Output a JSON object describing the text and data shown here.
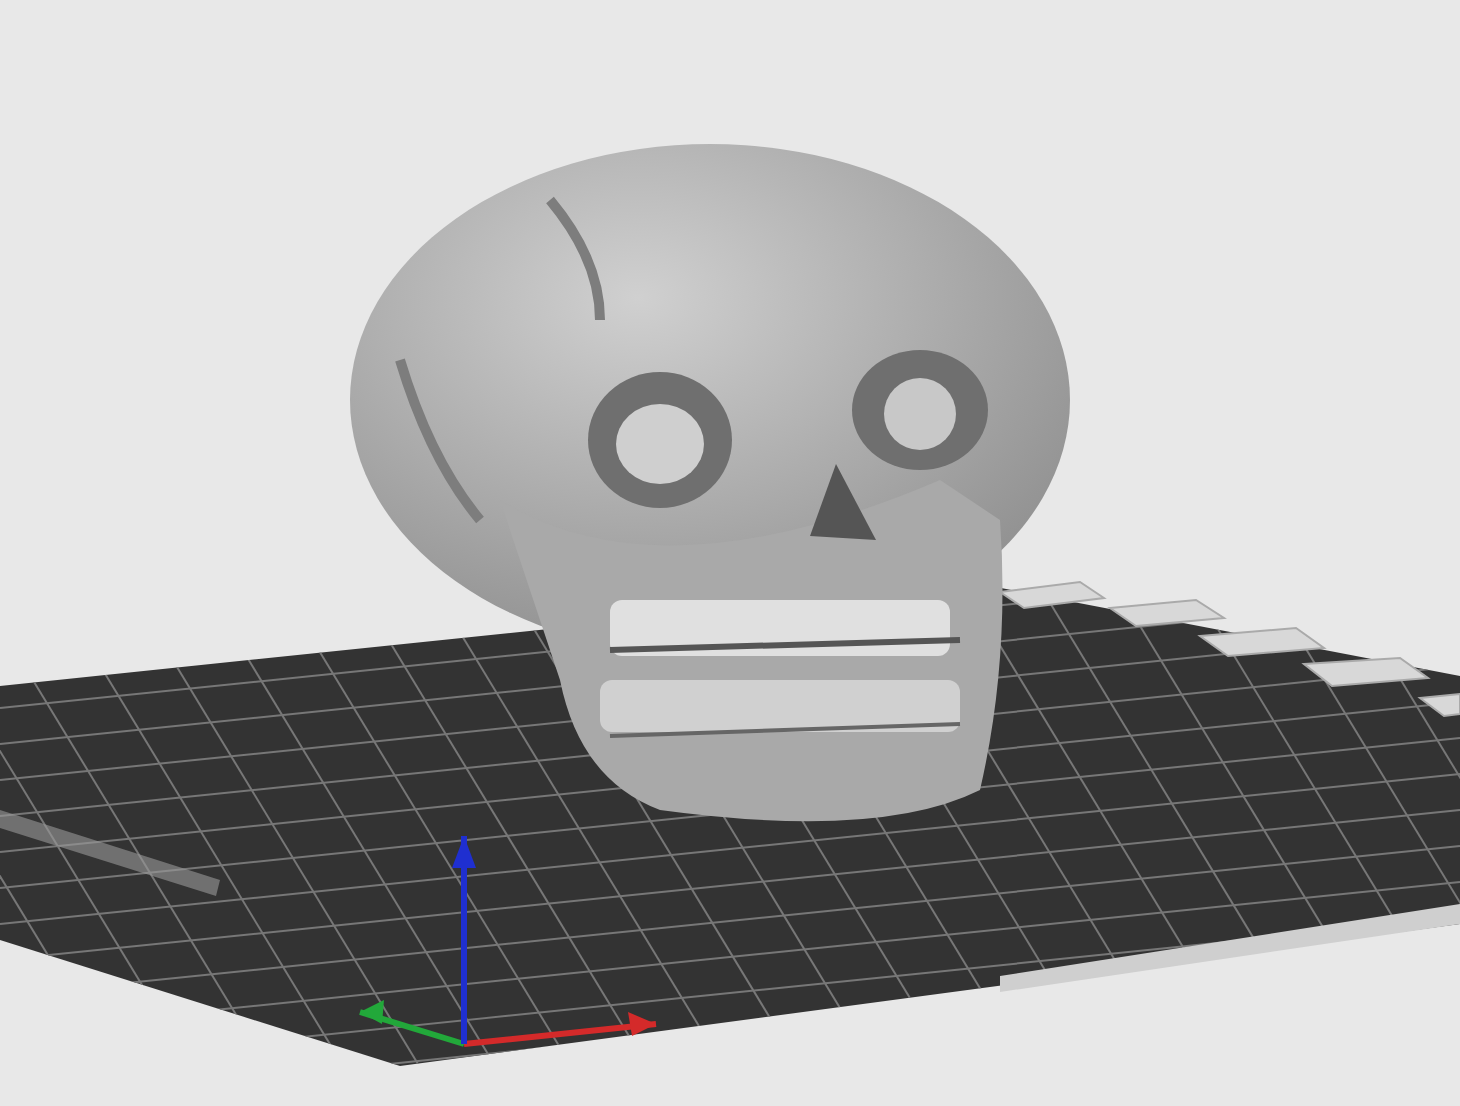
{
  "axes": [
    {
      "kind": "x",
      "color": "#d42a2a"
    },
    {
      "kind": "y",
      "color": "#22a83a"
    },
    {
      "kind": "z",
      "color": "#1f2fd0"
    }
  ]
}
